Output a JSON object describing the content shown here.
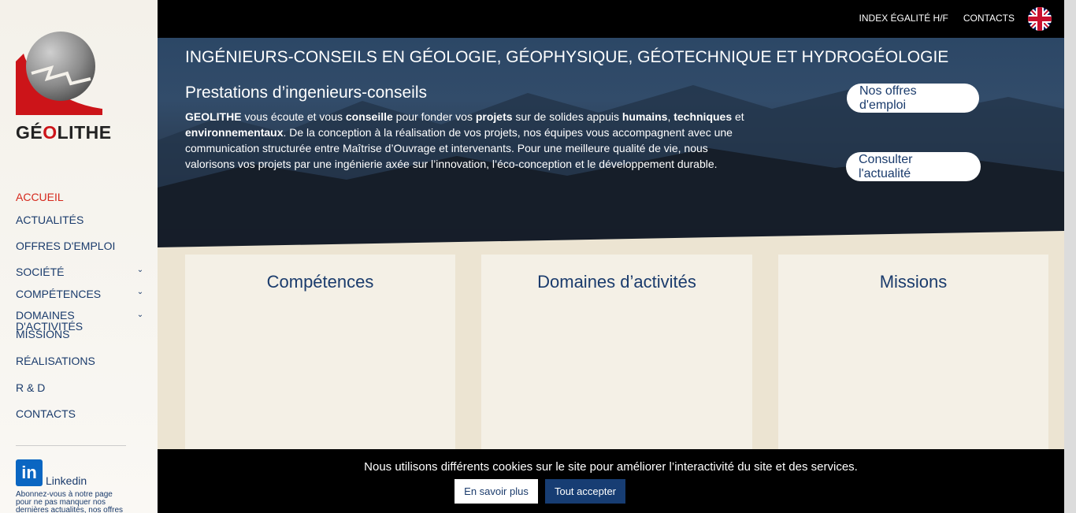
{
  "brand": {
    "name_pre": "GÉ",
    "name_o": "O",
    "name_post": "LITHE"
  },
  "topbar": {
    "links": [
      "INDEX ÉGALITÉ H/F",
      "CONTACTS"
    ],
    "lang_icon": "uk-flag-icon"
  },
  "nav": {
    "items": [
      {
        "label": "ACCUEIL",
        "active": true
      },
      {
        "label": "ACTUALITÉS"
      },
      {
        "label": "OFFRES D'EMPLOI"
      },
      {
        "label": "SOCIÉTÉ",
        "dropdown": true
      },
      {
        "label": "COMPÉTENCES",
        "dropdown": true
      },
      {
        "label": "DOMAINES D'ACTIVITÉS",
        "dropdown": true
      },
      {
        "label": "MISSIONS"
      },
      {
        "label": "RÉALISATIONS"
      },
      {
        "label": "R & D"
      },
      {
        "label": "CONTACTS"
      }
    ]
  },
  "linkedin": {
    "label": "Linkedin",
    "desc": "Abonnez-vous à notre page pour ne pas manquer nos dernières actualités, nos offres"
  },
  "hero": {
    "title": "INGÉNIEURS-CONSEILS EN GÉOLOGIE, GÉOPHYSIQUE, GÉOTECHNIQUE ET HYDROGÉOLOGIE",
    "subtitle": "Prestations d’ingenieurs-conseils",
    "t1": "GEOLITHE",
    "t2": " vous écoute et vous ",
    "t3": "conseille",
    "t4": " pour fonder vos ",
    "t5": "projets",
    "t6": " sur de solides appuis ",
    "t7": "humains",
    "t8": ", ",
    "t9": "techniques",
    "t10": " et ",
    "t11": "environnementaux",
    "t12": ". De la conception à la réalisation de vos projets, nos équipes vous accompagnent avec une communication structurée entre Maîtrise d’Ouvrage et intervenants. Pour une meilleure qualité de vie, nous valorisons vos projets par une ingénierie axée sur l’innovation, l’éco-conception et le développement durable.",
    "btn_jobs": "Nos offres d'emploi",
    "btn_news": "Consulter l'actualité"
  },
  "cards": [
    "Compétences",
    "Domaines d’activités",
    "Missions"
  ],
  "cookie": {
    "text": "Nous utilisons différents cookies sur le site pour améliorer l’interactivité du site et des services.",
    "more": "En savoir plus",
    "accept": "Tout accepter"
  }
}
